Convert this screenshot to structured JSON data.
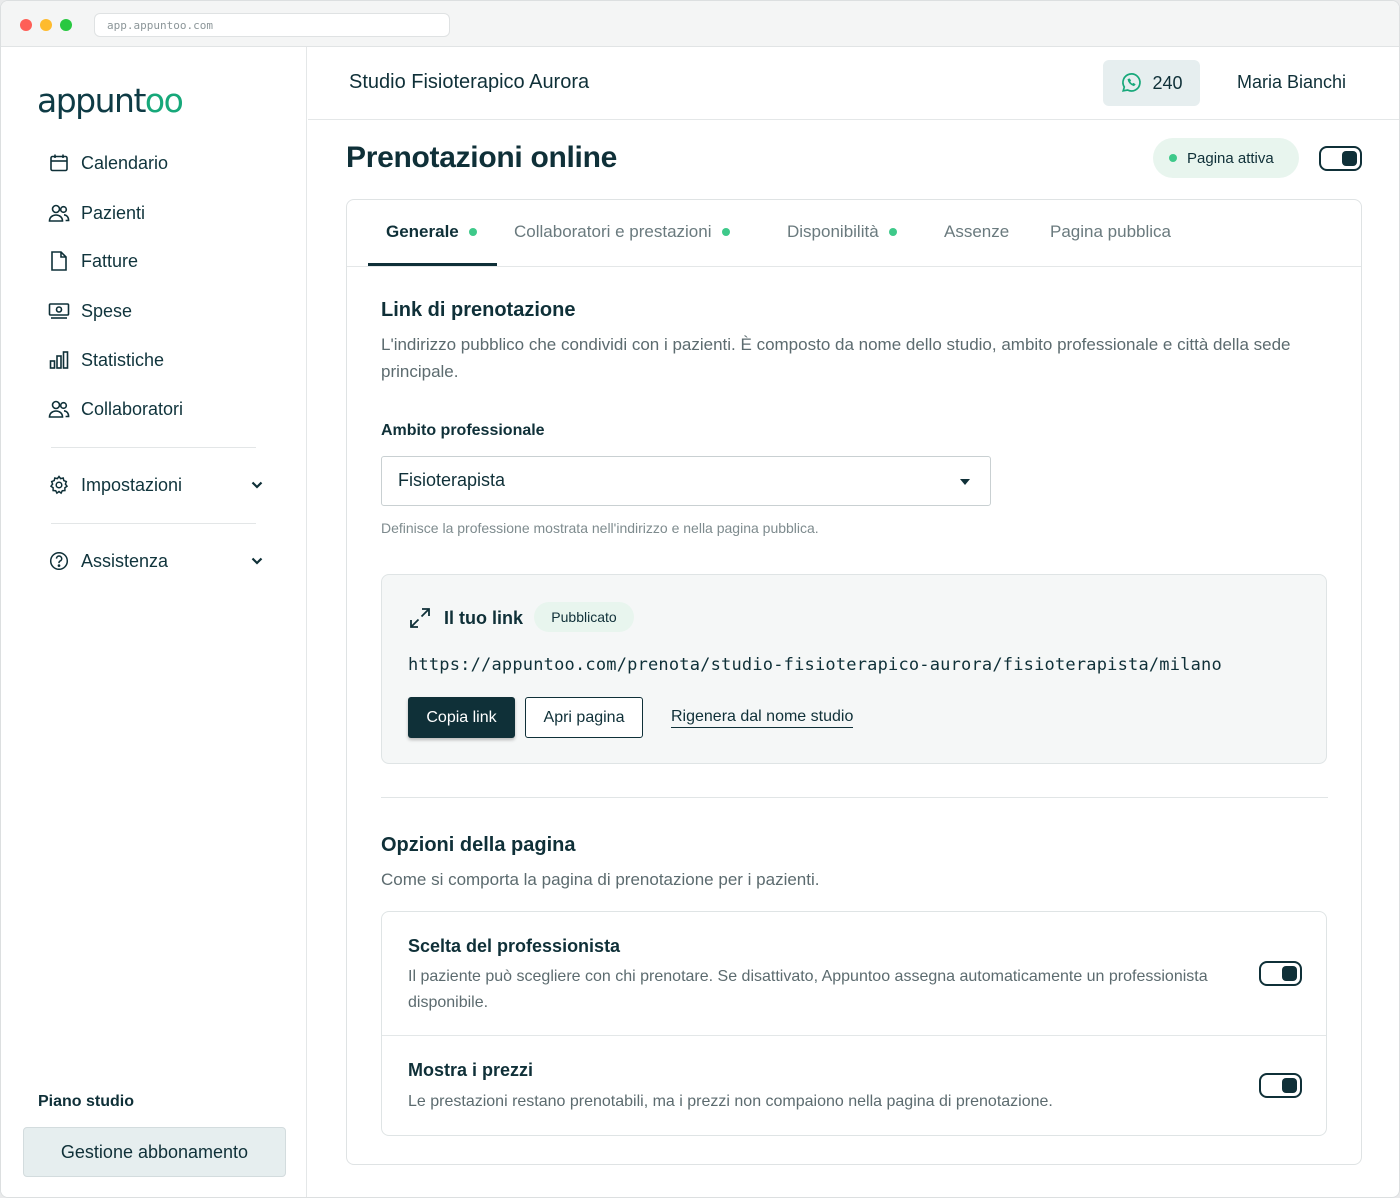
{
  "browser": {
    "url": "app.appuntoo.com"
  },
  "brand": {
    "logo_main": "appunt",
    "logo_accent": "oo",
    "accent_color": "#17a87a",
    "primary_color": "#0f3038"
  },
  "sidebar": {
    "items": [
      {
        "label": "Calendario",
        "icon": "calendar-icon"
      },
      {
        "label": "Pazienti",
        "icon": "users-icon"
      },
      {
        "label": "Fatture",
        "icon": "document-icon"
      },
      {
        "label": "Spese",
        "icon": "cash-icon"
      },
      {
        "label": "Statistiche",
        "icon": "bar-chart-icon"
      },
      {
        "label": "Collaboratori",
        "icon": "users-icon"
      }
    ],
    "settings_label": "Impostazioni",
    "help_label": "Assistenza",
    "plan_label": "Piano studio",
    "manage_label": "Gestione abbonamento"
  },
  "header": {
    "studio_name": "Studio Fisioterapico Aurora",
    "whatsapp_count": "240",
    "user_name": "Maria Bianchi"
  },
  "page": {
    "title": "Prenotazioni online",
    "status_label": "Pagina attiva",
    "page_active": true
  },
  "tabs": [
    {
      "label": "Generale",
      "dot": true,
      "active": true
    },
    {
      "label": "Collaboratori e prestazioni",
      "dot": true
    },
    {
      "label": "Disponibilità",
      "dot": true
    },
    {
      "label": "Assenze",
      "dot": false
    },
    {
      "label": "Pagina pubblica",
      "dot": false
    }
  ],
  "booking_link": {
    "title": "Link di prenotazione",
    "description": "L'indirizzo pubblico che condividi con i pazienti. È composto da nome dello studio, ambito professionale e città della sede principale.",
    "field_label": "Ambito professionale",
    "field_value": "Fisioterapista",
    "field_hint": "Definisce la professione mostrata nell'indirizzo e nella pagina pubblica.",
    "box_title": "Il tuo link",
    "badge": "Pubblicato",
    "url": "https://appuntoo.com/prenota/studio-fisioterapico-aurora/fisioterapista/milano",
    "copy_label": "Copia link",
    "open_label": "Apri pagina",
    "regenerate_label": "Rigenera dal nome studio"
  },
  "page_options": {
    "title": "Opzioni della pagina",
    "description": "Come si comporta la pagina di prenotazione per i pazienti.",
    "options": [
      {
        "title": "Scelta del professionista",
        "description": "Il paziente può scegliere con chi prenotare. Se disattivato, Appuntoo assegna automaticamente un professionista disponibile.",
        "enabled": true
      },
      {
        "title": "Mostra i prezzi",
        "description": "Le prestazioni restano prenotabili, ma i prezzi non compaiono nella pagina di prenotazione.",
        "enabled": true
      }
    ]
  }
}
